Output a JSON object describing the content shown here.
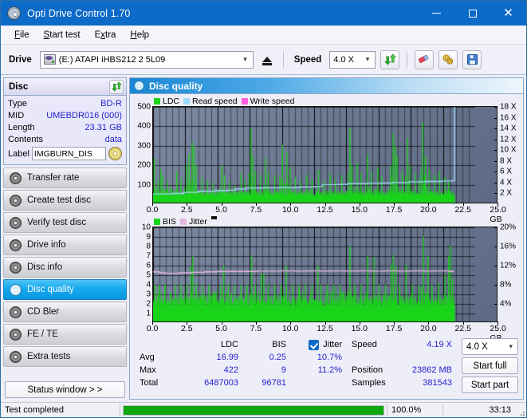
{
  "window": {
    "title": "Opti Drive Control 1.70",
    "title_icon": "disc-icon",
    "minimize": "–",
    "maximize": "□",
    "close": "✕"
  },
  "menu": [
    {
      "label": "File",
      "accel": "F"
    },
    {
      "label": "Start test",
      "accel": "S"
    },
    {
      "label": "Extra",
      "accel": "x"
    },
    {
      "label": "Help",
      "accel": "H"
    }
  ],
  "toolbar": {
    "drive_label": "Drive",
    "drive_value": "(E:)  ATAPI iHBS212  2 5L09",
    "eject_icon": "eject-icon",
    "speed_label": "Speed",
    "speed_value": "4.0 X",
    "refresh_icon": "refresh-icon",
    "eraser_icon": "eraser-icon",
    "settings_icon": "gears-icon",
    "save_icon": "floppy-save-icon"
  },
  "disc_panel": {
    "title": "Disc",
    "refresh_icon": "refresh-icon",
    "rows": [
      {
        "key": "Type",
        "value": "BD-R"
      },
      {
        "key": "MID",
        "value": "UMEBDR016 (000)"
      },
      {
        "key": "Length",
        "value": "23.31 GB"
      },
      {
        "key": "Contents",
        "value": "data"
      }
    ],
    "label_key": "Label",
    "label_value": "IMGBURN_DIS",
    "disc_icon": "cd-disc-icon"
  },
  "nav": {
    "items": [
      {
        "label": "Transfer rate",
        "icon": "disc-icon",
        "active": false
      },
      {
        "label": "Create test disc",
        "icon": "disc-icon",
        "active": false
      },
      {
        "label": "Verify test disc",
        "icon": "disc-icon",
        "active": false
      },
      {
        "label": "Drive info",
        "icon": "disc-icon",
        "active": false
      },
      {
        "label": "Disc info",
        "icon": "disc-icon",
        "active": false
      },
      {
        "label": "Disc quality",
        "icon": "disc-icon",
        "active": true
      },
      {
        "label": "CD Bler",
        "icon": "disc-icon",
        "active": false
      },
      {
        "label": "FE / TE",
        "icon": "disc-icon",
        "active": false
      },
      {
        "label": "Extra tests",
        "icon": "disc-icon",
        "active": false
      }
    ],
    "status_window_button": "Status window > >"
  },
  "main": {
    "header": "Disc quality",
    "header_icon": "disc-quality-icon"
  },
  "stats": {
    "columns": [
      "LDC",
      "BIS"
    ],
    "jitter_label": "Jitter",
    "jitter_checked": true,
    "rows": [
      {
        "label": "Avg",
        "ldc": "16.99",
        "bis": "0.25",
        "jitter": "10.7%"
      },
      {
        "label": "Max",
        "ldc": "422",
        "bis": "9",
        "jitter": "11.2%"
      },
      {
        "label": "Total",
        "ldc": "6487003",
        "bis": "96781",
        "jitter": ""
      }
    ],
    "right": [
      {
        "key": "Speed",
        "value": "4.19 X"
      },
      {
        "key": "Position",
        "value": "23862 MB"
      },
      {
        "key": "Samples",
        "value": "381543"
      }
    ],
    "speed_select": "4.0 X",
    "start_full": "Start full",
    "start_part": "Start part"
  },
  "statusbar": {
    "text": "Test completed",
    "percent": "100.0%",
    "progress": 100,
    "time": "33:13"
  },
  "colors": {
    "accent": "#0c6ac8",
    "ldc_green": "#1ad41a",
    "read_speed": "#9fd9f5",
    "write_speed": "#ff5ce0",
    "bis_green": "#1ad41a",
    "jitter_pink": "#e7b6e0",
    "value_blue": "#2222cc",
    "progress_green": "#0fa80f",
    "plot_bg_light": "#7d8aa4",
    "plot_bg_dark": "#5c6a84"
  },
  "chart_data": [
    {
      "type": "area",
      "name": "disc-quality-ldc-chart",
      "title": "",
      "legend": [
        {
          "label": "LDC",
          "color": "#1ad41a"
        },
        {
          "label": "Read speed",
          "color": "#9fd9f5"
        },
        {
          "label": "Write speed",
          "color": "#ff5ce0"
        }
      ],
      "legend_position": "top-left",
      "grid": true,
      "xlabel": "GB",
      "xlim": [
        0,
        25
      ],
      "xticks": [
        0.0,
        2.5,
        5.0,
        7.5,
        10.0,
        12.5,
        15.0,
        17.5,
        20.0,
        22.5,
        25.0
      ],
      "xticklabels": [
        "0.0",
        "2.5",
        "5.0",
        "7.5",
        "10.0",
        "12.5",
        "15.0",
        "17.5",
        "20.0",
        "22.5",
        "25.0 GB"
      ],
      "ylabel_left": "LDC",
      "ylim_left": [
        0,
        500
      ],
      "yticks_left": [
        100,
        200,
        300,
        400,
        500
      ],
      "ylabel_right": "Speed X",
      "ylim_right": [
        0,
        18
      ],
      "yticks_right": [
        2,
        4,
        6,
        8,
        10,
        12,
        14,
        16,
        18
      ],
      "yticklabels_right": [
        "2 X",
        "4 X",
        "6 X",
        "8 X",
        "10 X",
        "12 X",
        "14 X",
        "16 X",
        "18 X"
      ],
      "series": [
        {
          "name": "LDC",
          "color": "#1ad41a",
          "kind": "spikes",
          "baseline": 40,
          "noise": 30,
          "spikes": [
            [
              0.05,
              235
            ],
            [
              0.35,
              120
            ],
            [
              0.55,
              180
            ],
            [
              0.7,
              145
            ],
            [
              1.05,
              120
            ],
            [
              1.35,
              90
            ],
            [
              1.8,
              170
            ],
            [
              2.1,
              130
            ],
            [
              2.55,
              205
            ],
            [
              2.75,
              260
            ],
            [
              3.0,
              318
            ],
            [
              3.15,
              300
            ],
            [
              3.3,
              200
            ],
            [
              3.75,
              140
            ],
            [
              4.2,
              125
            ],
            [
              4.6,
              110
            ],
            [
              5.3,
              200
            ],
            [
              5.5,
              150
            ],
            [
              5.9,
              120
            ],
            [
              6.3,
              95
            ],
            [
              6.8,
              160
            ],
            [
              7.1,
              120
            ],
            [
              7.55,
              388
            ],
            [
              7.7,
              250
            ],
            [
              7.9,
              170
            ],
            [
              8.3,
              150
            ],
            [
              8.7,
              235
            ],
            [
              8.9,
              160
            ],
            [
              9.4,
              150
            ],
            [
              9.8,
              140
            ],
            [
              10.0,
              305
            ],
            [
              10.35,
              270
            ],
            [
              10.6,
              190
            ],
            [
              11.0,
              140
            ],
            [
              11.4,
              120
            ],
            [
              11.9,
              150
            ],
            [
              12.3,
              130
            ],
            [
              12.8,
              175
            ],
            [
              13.2,
              120
            ],
            [
              13.7,
              160
            ],
            [
              14.1,
              130
            ],
            [
              14.6,
              150
            ],
            [
              15.25,
              390
            ],
            [
              15.4,
              200
            ],
            [
              15.8,
              215
            ],
            [
              16.1,
              160
            ],
            [
              16.6,
              255
            ],
            [
              16.9,
              170
            ],
            [
              17.4,
              190
            ],
            [
              17.7,
              145
            ],
            [
              18.4,
              200
            ],
            [
              18.6,
              365
            ],
            [
              18.75,
              300
            ],
            [
              18.9,
              250
            ],
            [
              19.3,
              170
            ],
            [
              19.7,
              340
            ],
            [
              19.9,
              200
            ],
            [
              20.3,
              160
            ],
            [
              20.6,
              130
            ],
            [
              20.9,
              420
            ],
            [
              21.1,
              250
            ],
            [
              21.4,
              180
            ],
            [
              21.8,
              150
            ],
            [
              22.2,
              170
            ],
            [
              22.6,
              140
            ],
            [
              22.9,
              120
            ]
          ]
        },
        {
          "name": "Read speed",
          "color": "#9fd9f5",
          "kind": "line",
          "points": [
            [
              0.0,
              1.9
            ],
            [
              1.5,
              2.0
            ],
            [
              2.4,
              2.2
            ],
            [
              3.5,
              2.4
            ],
            [
              4.8,
              2.5
            ],
            [
              5.8,
              2.6
            ],
            [
              6.4,
              2.8
            ],
            [
              7.2,
              3.0
            ],
            [
              8.6,
              3.05
            ],
            [
              10.0,
              3.1
            ],
            [
              11.4,
              3.2
            ],
            [
              12.7,
              3.3
            ],
            [
              13.1,
              3.6
            ],
            [
              14.4,
              3.65
            ],
            [
              15.1,
              3.8
            ],
            [
              16.6,
              3.85
            ],
            [
              17.6,
              3.9
            ],
            [
              18.6,
              4.0
            ],
            [
              19.9,
              4.15
            ],
            [
              21.2,
              4.2
            ],
            [
              22.4,
              4.3
            ],
            [
              23.3,
              4.35
            ],
            [
              23.4,
              18.0
            ]
          ]
        },
        {
          "name": "Write speed",
          "color": "#ff5ce0",
          "kind": "line",
          "points": []
        }
      ],
      "data_end_gb": 23.4
    },
    {
      "type": "area",
      "name": "disc-quality-bis-chart",
      "title": "",
      "legend": [
        {
          "label": "BIS",
          "color": "#1ad41a"
        },
        {
          "label": "Jitter",
          "color": "#e7b6e0"
        }
      ],
      "legend_position": "top-left",
      "grid": true,
      "xlabel": "GB",
      "xlim": [
        0,
        25
      ],
      "xticks": [
        0.0,
        2.5,
        5.0,
        7.5,
        10.0,
        12.5,
        15.0,
        17.5,
        20.0,
        22.5,
        25.0
      ],
      "xticklabels": [
        "0.0",
        "2.5",
        "5.0",
        "7.5",
        "10.0",
        "12.5",
        "15.0",
        "17.5",
        "20.0",
        "22.5",
        "25.0 GB"
      ],
      "ylabel_left": "BIS",
      "ylim_left": [
        0,
        10
      ],
      "yticks_left": [
        1,
        2,
        3,
        4,
        5,
        6,
        7,
        8,
        9,
        10
      ],
      "ylabel_right": "Jitter %",
      "ylim_right": [
        0,
        20
      ],
      "yticks_right": [
        4,
        8,
        12,
        16,
        20
      ],
      "yticklabels_right": [
        "4%",
        "8%",
        "12%",
        "16%",
        "20%"
      ],
      "series": [
        {
          "name": "BIS",
          "color": "#1ad41a",
          "kind": "spikes",
          "baseline": 1.6,
          "noise": 1.5,
          "spikes": [
            [
              0.1,
              4.0
            ],
            [
              0.45,
              4.0
            ],
            [
              0.9,
              4.0
            ],
            [
              1.3,
              3.1
            ],
            [
              1.7,
              4.0
            ],
            [
              2.1,
              4.0
            ],
            [
              2.55,
              4.1
            ],
            [
              2.9,
              6.0
            ],
            [
              3.05,
              7.0
            ],
            [
              3.3,
              4.2
            ],
            [
              3.8,
              4.0
            ],
            [
              4.3,
              4.0
            ],
            [
              4.7,
              3.3
            ],
            [
              5.2,
              4.0
            ],
            [
              5.45,
              6.0
            ],
            [
              5.8,
              4.0
            ],
            [
              6.3,
              4.0
            ],
            [
              6.8,
              4.0
            ],
            [
              7.25,
              4.0
            ],
            [
              7.6,
              7.1
            ],
            [
              7.9,
              4.0
            ],
            [
              8.35,
              5.2
            ],
            [
              8.55,
              5.1
            ],
            [
              8.9,
              4.0
            ],
            [
              9.4,
              4.0
            ],
            [
              9.9,
              4.0
            ],
            [
              10.3,
              6.0
            ],
            [
              10.8,
              4.0
            ],
            [
              11.3,
              4.0
            ],
            [
              11.8,
              4.1
            ],
            [
              12.3,
              4.0
            ],
            [
              12.75,
              6.0
            ],
            [
              13.0,
              4.0
            ],
            [
              13.5,
              4.0
            ],
            [
              14.0,
              4.0
            ],
            [
              14.5,
              4.0
            ],
            [
              15.25,
              8.0
            ],
            [
              15.6,
              4.0
            ],
            [
              16.1,
              4.0
            ],
            [
              16.6,
              7.0
            ],
            [
              17.1,
              6.9
            ],
            [
              17.5,
              4.0
            ],
            [
              18.0,
              4.0
            ],
            [
              18.45,
              6.1
            ],
            [
              18.6,
              7.1
            ],
            [
              18.8,
              6.0
            ],
            [
              19.1,
              4.0
            ],
            [
              19.6,
              6.1
            ],
            [
              20.1,
              4.0
            ],
            [
              20.6,
              4.0
            ],
            [
              20.95,
              9.1
            ],
            [
              21.3,
              7.0
            ],
            [
              21.6,
              4.0
            ],
            [
              22.1,
              4.2
            ],
            [
              22.6,
              5.0
            ],
            [
              22.9,
              7.0
            ],
            [
              23.05,
              8.1
            ],
            [
              23.2,
              4.6
            ]
          ]
        },
        {
          "name": "Jitter",
          "color": "#e7b6e0",
          "kind": "line",
          "points": [
            [
              0.0,
              10.7
            ],
            [
              0.5,
              10.5
            ],
            [
              1.0,
              10.4
            ],
            [
              2.0,
              10.5
            ],
            [
              3.0,
              10.6
            ],
            [
              4.0,
              10.7
            ],
            [
              5.0,
              10.8
            ],
            [
              6.0,
              10.8
            ],
            [
              7.0,
              10.8
            ],
            [
              8.0,
              10.85
            ],
            [
              9.0,
              10.85
            ],
            [
              10.0,
              10.9
            ],
            [
              11.0,
              10.85
            ],
            [
              12.0,
              10.9
            ],
            [
              13.0,
              10.85
            ],
            [
              14.0,
              10.9
            ],
            [
              15.0,
              10.85
            ],
            [
              16.0,
              10.9
            ],
            [
              17.0,
              10.85
            ],
            [
              18.0,
              10.9
            ],
            [
              19.0,
              10.85
            ],
            [
              20.0,
              10.9
            ],
            [
              21.0,
              10.85
            ],
            [
              22.0,
              10.9
            ],
            [
              23.0,
              10.8
            ],
            [
              23.3,
              11.0
            ]
          ]
        }
      ],
      "data_end_gb": 23.4
    }
  ]
}
